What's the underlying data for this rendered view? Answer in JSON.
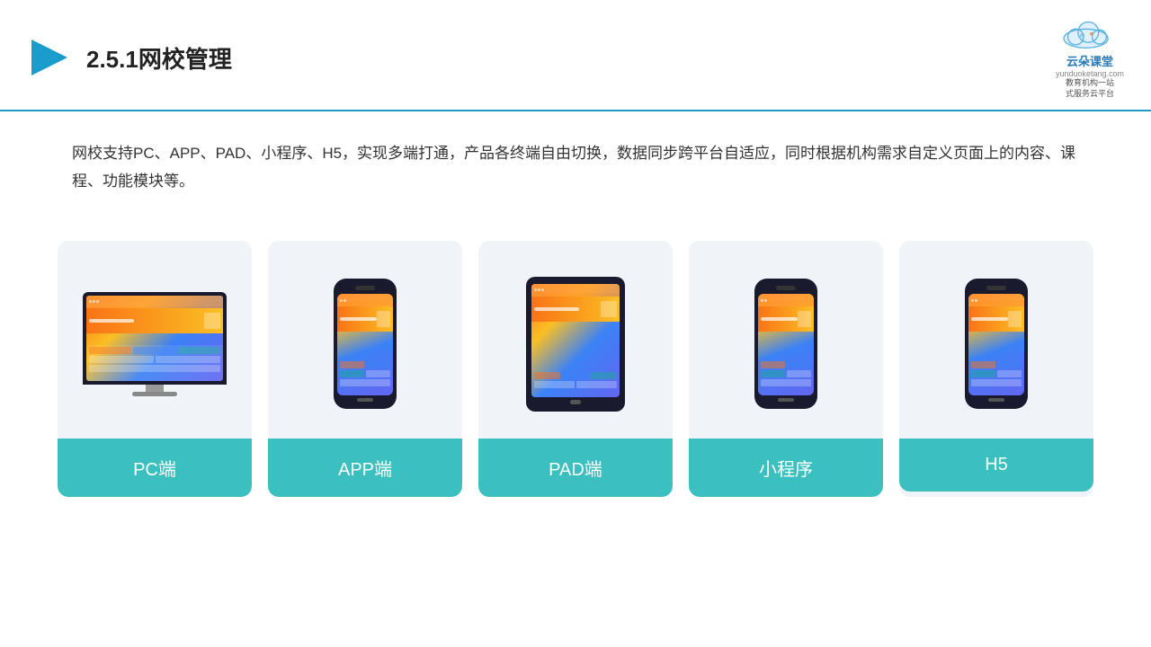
{
  "header": {
    "title": "2.5.1网校管理",
    "logo_name": "云朵课堂",
    "logo_sub": "yunduoketang.com",
    "logo_tagline": "教育机构一站\n式服务云平台"
  },
  "description": {
    "text": "网校支持PC、APP、PAD、小程序、H5，实现多端打通，产品各终端自由切换，数据同步跨平台自适应，同时根据机构需求自定义页面上的内容、课程、功能模块等。"
  },
  "cards": [
    {
      "id": "pc",
      "label": "PC端",
      "type": "pc"
    },
    {
      "id": "app",
      "label": "APP端",
      "type": "phone"
    },
    {
      "id": "pad",
      "label": "PAD端",
      "type": "tablet"
    },
    {
      "id": "miniapp",
      "label": "小程序",
      "type": "phone"
    },
    {
      "id": "h5",
      "label": "H5",
      "type": "phone"
    }
  ],
  "colors": {
    "accent": "#3bbfbf",
    "header_line": "#1a9dcc",
    "title": "#222222",
    "bg_card": "#f0f4f8",
    "label_bg": "#3bbfbf"
  }
}
